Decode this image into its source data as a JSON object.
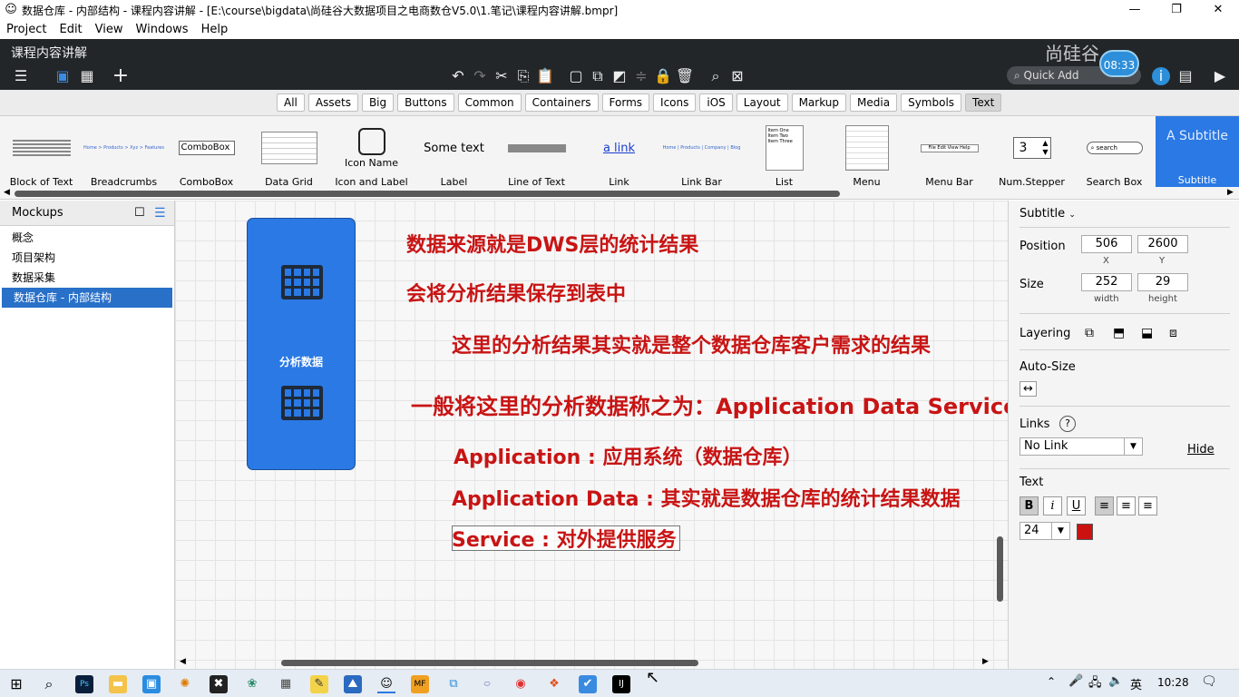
{
  "window": {
    "title": "数据仓库 - 内部结构 - 课程内容讲解 - [E:\\course\\bigdata\\尚硅谷大数据项目之电商数仓V5.0\\1.笔记\\课程内容讲解.bmpr]",
    "minimize": "—",
    "maximize": "❐",
    "close": "✕"
  },
  "menu": [
    "Project",
    "Edit",
    "View",
    "Windows",
    "Help"
  ],
  "toolbar": {
    "doc_title": "课程内容讲解",
    "quick_add_placeholder": "Quick Add",
    "watermark": "尚硅谷",
    "time_badge": "08:33"
  },
  "filter_tabs": [
    "All",
    "Assets",
    "Big",
    "Buttons",
    "Common",
    "Containers",
    "Forms",
    "Icons",
    "iOS",
    "Layout",
    "Markup",
    "Media",
    "Symbols",
    "Text"
  ],
  "active_filter": "Text",
  "library": [
    {
      "label": "Block of Text"
    },
    {
      "label": "Breadcrumbs",
      "preview": "Home > Products > Xyz > Features"
    },
    {
      "label": "ComboBox",
      "preview": "ComboBox"
    },
    {
      "label": "Data Grid"
    },
    {
      "label": "Icon and Label",
      "preview": "Icon Name"
    },
    {
      "label": "Label",
      "preview": "Some text"
    },
    {
      "label": "Line of Text"
    },
    {
      "label": "Link",
      "preview": "a link"
    },
    {
      "label": "Link Bar",
      "preview": "Home | Products | Company | Blog"
    },
    {
      "label": "List",
      "preview": "Item One\nItem Two\nItem Three"
    },
    {
      "label": "Menu"
    },
    {
      "label": "Menu Bar",
      "preview": "File  Edit  View  Help"
    },
    {
      "label": "Num.Stepper",
      "preview": "3"
    },
    {
      "label": "Search Box",
      "preview": "search"
    },
    {
      "label": "Subtitle",
      "preview": "A Subtitle"
    }
  ],
  "mockups": {
    "header": "Mockups",
    "items": [
      "概念",
      "项目架构",
      "数据采集",
      "数据仓库 - 内部结构"
    ],
    "selected_index": 3
  },
  "canvas": {
    "box_label": "分析数据",
    "texts": [
      "数据来源就是DWS层的统计结果",
      "会将分析结果保存到表中",
      "这里的分析结果其实就是整个数据仓库客户需求的结果",
      "一般将这里的分析数据称之为：Application Data Service",
      "Application : 应用系统（数据仓库）",
      "Application Data : 其实就是数据仓库的统计结果数据",
      "Service : 对外提供服务"
    ]
  },
  "properties": {
    "component": "Subtitle",
    "position_label": "Position",
    "x": "506",
    "y": "2600",
    "x_label": "X",
    "y_label": "Y",
    "size_label": "Size",
    "width": "252",
    "height": "29",
    "width_label": "width",
    "height_label": "height",
    "layering_label": "Layering",
    "autosize_label": "Auto-Size",
    "links_label": "Links",
    "links_value": "No Link",
    "hide_label": "Hide",
    "text_label": "Text",
    "font_size": "24",
    "bold": "B",
    "italic": "i",
    "underline": "U",
    "text_color": "#cc1111"
  },
  "taskbar": {
    "ime": "英",
    "time": "10:28"
  }
}
